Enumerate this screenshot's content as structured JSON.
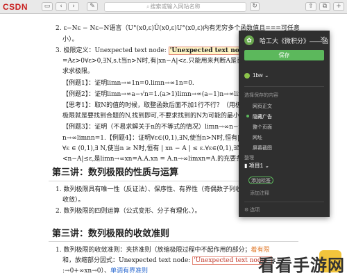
{
  "browser": {
    "logo": "CSDN",
    "url_placeholder": "搜索或输入网站名称",
    "right_links": "Tab · Wiki · ▸"
  },
  "doc": {
    "line2": "2. ε−Nε − Nε−N语言（U°(x0,ε)Ū(x0,ε)U°(x0,ε)内有无穷多个函数值且===可任意",
    "line2b": "小）。",
    "line3_prefix": "3. 极限定义：Unexpected text node: ",
    "line3_hl": "'Unexpected text node: '",
    "line3_suffix": "n−",
    "line4": "=Aε>0∀ε>0,∃N,s.t当n>N时,有|xn−A|<ε.只能用来判断A是否是极限,",
    "line5": "求求极限。",
    "ex1": "【例题1】：证明limn→∞1n=0.limn→∞1n=0.",
    "ex2": "【例题2】：证明limn→∞a−√n=1.(a>1)limn→∞(a−1)n→∞lim",
    "think1": "【思考1】：取N的值的时候，取整函数后面不加1行不行？（用极",
    "think1b": "极限就是要找到合题的N,找到即可,不要求找到的N为可能的最小值",
    "ex3": "【例题3】：证明（不易求解关于n的不等式的情况）limn→∞n−n",
    "ex4": "n→∞limnn=1.【例题4】：证明∀ε∈(0,1),∃N,使当n>N时,恒有|x",
    "ex4b": "∀ε ∈ (0,1),∃ N,使当n ≥ N时,恒有 | xn − A | ≤ ε.∀ε∈(0,1),∃N,使",
    "ex4c": "<n−A|≤ε,是limn→∞xn=A.A.xn = A.n→∞limxn=A.的充要条件。",
    "lecture3a_title": "第三讲：数列极限的性质与运算",
    "l3a_item1": "1. 数列极限具有唯一性（反证法）、保序性、有界性（奇偶数子列收",
    "l3a_item1b": "收敛）。",
    "l3a_item2": "2. 数列极限的四则运算（公式变形、分子有理化、）。",
    "lecture3b_title": "第三讲：数列极限的收敛准则",
    "l3b_item1_prefix": "1. 数列极限的收敛准则：夹挤准则（放缩极限过程中不起作用的部分；",
    "l3b_item1_link": "着有限",
    "l3b_item1b_prefix": "和，放缩部分因式：Unexpected text node: ",
    "l3b_item1b_hl": "'Unexpected text node: '",
    "l3b_item1b_suffix": "x",
    "l3b_item1c_prefix": ":→0+∞xn→0）、",
    "l3b_item1c_link": "单调有界准则"
  },
  "panel": {
    "title": "哈工大《微积分》——函",
    "save": "保存",
    "user": "1bw",
    "section_label": "选择保存的内容",
    "options": [
      "网页正文",
      "隐藏广告",
      "整个页面",
      "网址",
      "屏幕截图"
    ],
    "selected_index": 1,
    "organize_label": "整理",
    "notebook": "项目1",
    "tag_button": "添加标签",
    "add_note": "添加注释",
    "footer": "选项"
  },
  "watermark": {
    "text": "看看手游网"
  },
  "colors": {
    "panel_bg": "#2f2f2f",
    "accent": "#5cb85c",
    "highlight_border": "#e58b7b"
  }
}
